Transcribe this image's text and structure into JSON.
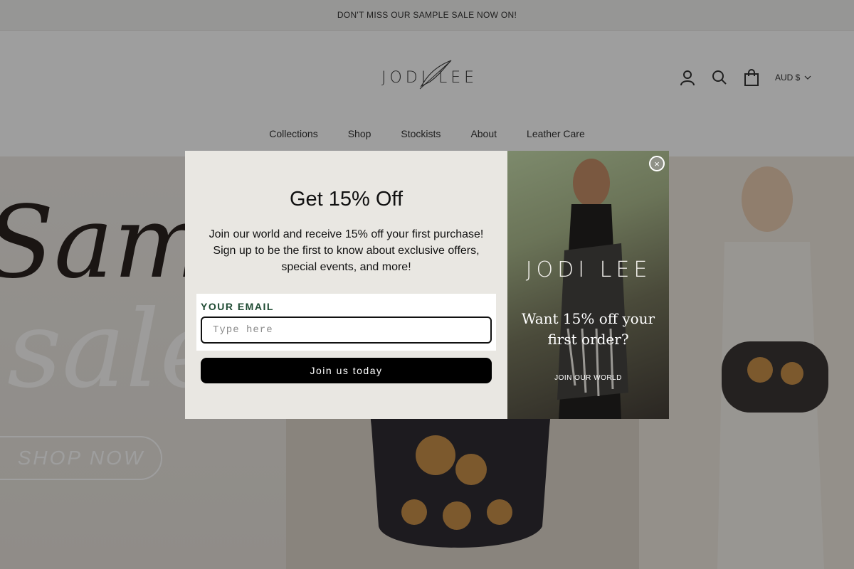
{
  "announcement": "DON'T MISS OUR SAMPLE SALE NOW ON!",
  "brand": {
    "logo_text": "JODI LEE"
  },
  "header": {
    "currency": "AUD $",
    "icons": [
      "account-icon",
      "search-icon",
      "cart-icon"
    ]
  },
  "nav": [
    {
      "label": "Collections"
    },
    {
      "label": "Shop"
    },
    {
      "label": "Stockists"
    },
    {
      "label": "About"
    },
    {
      "label": "Leather Care"
    }
  ],
  "hero": {
    "script_line1": "Sampl",
    "script_line2": "sale",
    "shop_now": "SHOP NOW"
  },
  "popup": {
    "title": "Get 15% Off",
    "body": "Join our world and receive 15% off your first purchase! Sign up to be the first to know about exclusive offers, special events, and more!",
    "email_label": "YOUR EMAIL",
    "email_placeholder": "Type here",
    "email_value": "",
    "submit_label": "Join us today",
    "image_logo": "JODI LEE",
    "image_headline": "Want 15% off your first order?",
    "image_cta": "JOIN OUR WORLD",
    "close_label": "×"
  },
  "colors": {
    "overlay": "#000000",
    "popup_bg": "#e9e7e2",
    "button_bg": "#000000",
    "email_label": "#1e4a32"
  }
}
